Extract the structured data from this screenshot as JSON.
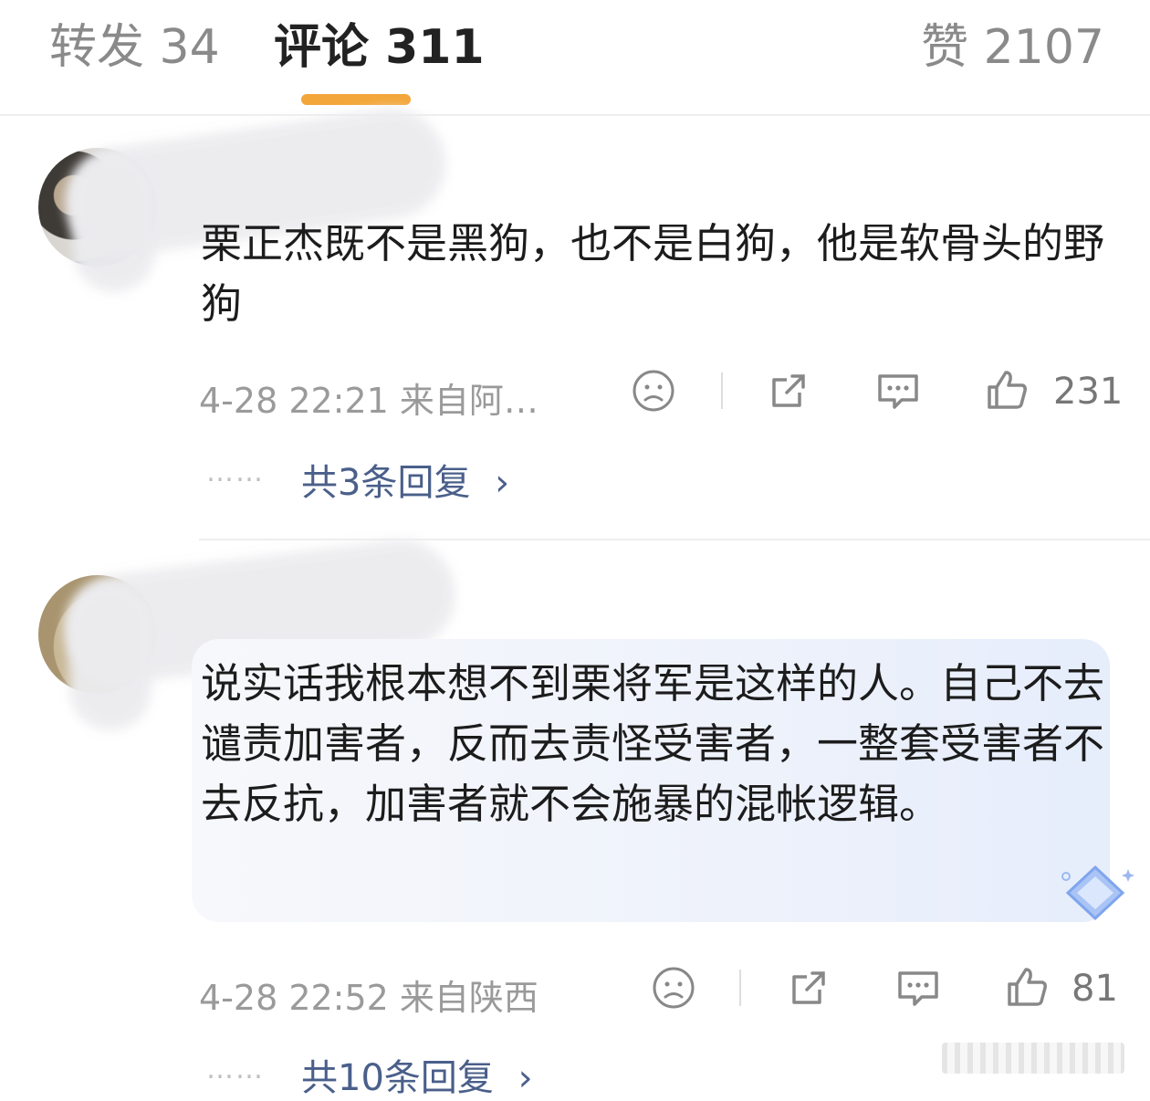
{
  "tabs": {
    "reposts": "转发 34",
    "comments": "评论 311",
    "likes": "赞 2107"
  },
  "comments": [
    {
      "text": "栗正杰既不是黑狗，也不是白狗，他是软骨头的野狗",
      "time": "4-28 22:21  来自阿…",
      "likes": "231",
      "replies": "共3条回复"
    },
    {
      "text": "说实话我根本想不到栗将军是这样的人。自己不去谴责加害者，反而去责怪受害者，一整套受害者不去反抗，加害者就不会施暴的混帐逻辑。",
      "time": "4-28 22:52  来自陕西",
      "likes": "81",
      "replies": "共10条回复"
    }
  ],
  "ui": {
    "reply_dots": "……",
    "reply_chevron": "›"
  }
}
